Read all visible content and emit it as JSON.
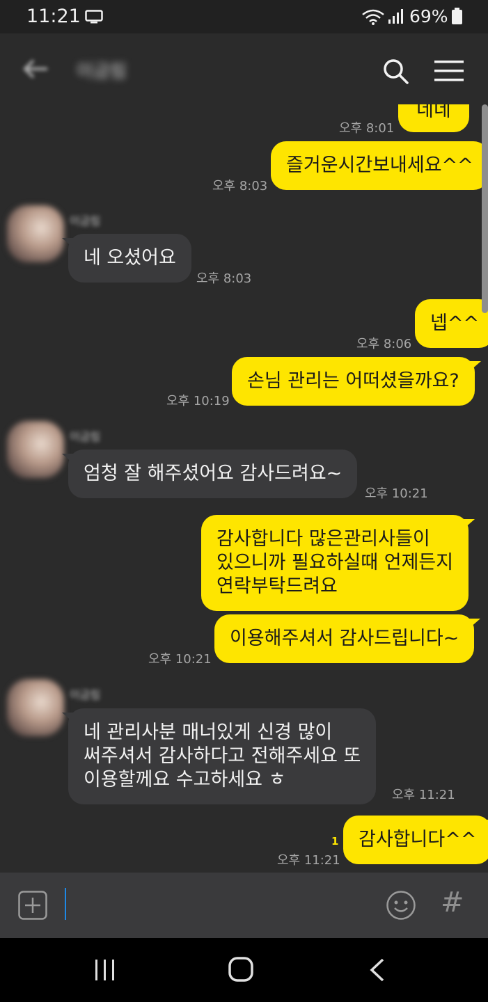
{
  "status_bar": {
    "time": "11:21",
    "battery": "69%"
  },
  "header": {
    "title": "이금림"
  },
  "messages": [
    {
      "side": "me",
      "text": "네네",
      "time": "오후 8:01"
    },
    {
      "side": "me",
      "text": "즐거운시간보내세요^^",
      "time": "오후 8:03"
    },
    {
      "side": "them",
      "sender": "이금림",
      "text": "네 오셨어요",
      "time": "오후 8:03"
    },
    {
      "side": "me",
      "text": "넵^^",
      "time": "오후 8:06"
    },
    {
      "side": "me",
      "text": "손님 관리는 어떠셨을까요?",
      "time": "오후 10:19"
    },
    {
      "side": "them",
      "sender": "이금림",
      "text": "엄청 잘 해주셨어요 감사드려요~",
      "time": "오후 10:21"
    },
    {
      "side": "me",
      "lines": [
        "감사합니다 많은관리사들이",
        "있으니까 필요하실때 언제든지",
        "연락부탁드려요"
      ]
    },
    {
      "side": "me",
      "text": "이용해주셔서 감사드립니다~",
      "time": "오후 10:21"
    },
    {
      "side": "them",
      "sender": "이금림",
      "lines": [
        "네 관리사분 매너있게 신경 많이",
        "써주셔서 감사하다고 전해주세요 또",
        "이용할께요 수고하세요 ㅎ"
      ],
      "time": "오후 11:21"
    },
    {
      "side": "me",
      "text": "감사합니다^^",
      "time": "오후 11:21",
      "unread": "1"
    }
  ],
  "input": {
    "placeholder": ""
  },
  "icons": {
    "back": "back-arrow-icon",
    "search": "search-icon",
    "menu": "hamburger-menu-icon",
    "plus": "plus-icon",
    "emoji": "emoji-icon",
    "hash": "#"
  },
  "colors": {
    "my_bubble": "#fee500",
    "their_bubble": "#3a3a3c",
    "background": "#2b2b2b"
  }
}
